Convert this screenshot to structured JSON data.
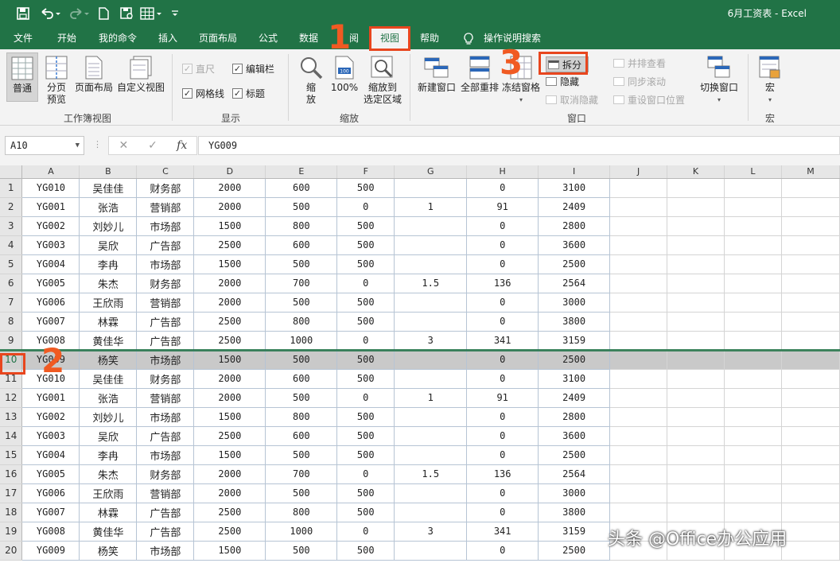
{
  "window": {
    "title": "6月工资表 - Excel"
  },
  "quick_access": {
    "icons": [
      "save-icon",
      "undo-icon",
      "redo-icon",
      "new-file-icon",
      "print-preview-icon",
      "table-icon",
      "customize-icon"
    ]
  },
  "tabs": [
    "文件",
    "开始",
    "我的命令",
    "插入",
    "页面布局",
    "公式",
    "数据",
    "审阅",
    "视图",
    "帮助"
  ],
  "tab_partial": "阅",
  "tab_active": "视图",
  "tell_me": "操作说明搜索",
  "ribbon": {
    "workbook_views": {
      "label": "工作簿视图",
      "buttons": [
        "普通",
        "分页\n预览",
        "页面布局",
        "自定义视图"
      ]
    },
    "show": {
      "label": "显示",
      "ruler": "直尺",
      "formula_bar": "编辑栏",
      "gridlines": "网格线",
      "headings": "标题"
    },
    "zoom": {
      "label": "缩放",
      "zoom": "缩\n放",
      "zoom100": "100%",
      "zoom_selection": "缩放到\n选定区域"
    },
    "window": {
      "label": "窗口",
      "new_window": "新建窗口",
      "arrange_all": "全部重排",
      "freeze_panes": "冻结窗格",
      "split": "拆分",
      "hide": "隐藏",
      "unhide": "取消隐藏",
      "view_side_by_side": "并排查看",
      "sync_scroll": "同步滚动",
      "reset_position": "重设窗口位置",
      "switch_windows": "切换窗口"
    },
    "macros": {
      "label": "宏",
      "button": "宏"
    }
  },
  "formula_bar": {
    "name_box": "A10",
    "cancel": "✕",
    "enter": "✓",
    "fx": "fx",
    "value": "YG009"
  },
  "sheet": {
    "columns": [
      "A",
      "B",
      "C",
      "D",
      "E",
      "F",
      "G",
      "H",
      "I",
      "J",
      "K",
      "L",
      "M"
    ],
    "selected_row": 10,
    "rows": [
      [
        "1",
        "YG010",
        "吴佳佳",
        "财务部",
        "2000",
        "600",
        "500",
        "",
        "0",
        "3100"
      ],
      [
        "2",
        "YG001",
        "张浩",
        "营销部",
        "2000",
        "500",
        "0",
        "1",
        "91",
        "2409"
      ],
      [
        "3",
        "YG002",
        "刘妙儿",
        "市场部",
        "1500",
        "800",
        "500",
        "",
        "0",
        "2800"
      ],
      [
        "4",
        "YG003",
        "吴欣",
        "广告部",
        "2500",
        "600",
        "500",
        "",
        "0",
        "3600"
      ],
      [
        "5",
        "YG004",
        "李冉",
        "市场部",
        "1500",
        "500",
        "500",
        "",
        "0",
        "2500"
      ],
      [
        "6",
        "YG005",
        "朱杰",
        "财务部",
        "2000",
        "700",
        "0",
        "1.5",
        "136",
        "2564"
      ],
      [
        "7",
        "YG006",
        "王欣雨",
        "营销部",
        "2000",
        "500",
        "500",
        "",
        "0",
        "3000"
      ],
      [
        "8",
        "YG007",
        "林霖",
        "广告部",
        "2500",
        "800",
        "500",
        "",
        "0",
        "3800"
      ],
      [
        "9",
        "YG008",
        "黄佳华",
        "广告部",
        "2500",
        "1000",
        "0",
        "3",
        "341",
        "3159"
      ],
      [
        "10",
        "YG009",
        "杨笑",
        "市场部",
        "1500",
        "500",
        "500",
        "",
        "0",
        "2500"
      ],
      [
        "11",
        "YG010",
        "吴佳佳",
        "财务部",
        "2000",
        "600",
        "500",
        "",
        "0",
        "3100"
      ],
      [
        "12",
        "YG001",
        "张浩",
        "营销部",
        "2000",
        "500",
        "0",
        "1",
        "91",
        "2409"
      ],
      [
        "13",
        "YG002",
        "刘妙儿",
        "市场部",
        "1500",
        "800",
        "500",
        "",
        "0",
        "2800"
      ],
      [
        "14",
        "YG003",
        "吴欣",
        "广告部",
        "2500",
        "600",
        "500",
        "",
        "0",
        "3600"
      ],
      [
        "15",
        "YG004",
        "李冉",
        "市场部",
        "1500",
        "500",
        "500",
        "",
        "0",
        "2500"
      ],
      [
        "16",
        "YG005",
        "朱杰",
        "财务部",
        "2000",
        "700",
        "0",
        "1.5",
        "136",
        "2564"
      ],
      [
        "17",
        "YG006",
        "王欣雨",
        "营销部",
        "2000",
        "500",
        "500",
        "",
        "0",
        "3000"
      ],
      [
        "18",
        "YG007",
        "林霖",
        "广告部",
        "2500",
        "800",
        "500",
        "",
        "0",
        "3800"
      ],
      [
        "19",
        "YG008",
        "黄佳华",
        "广告部",
        "2500",
        "1000",
        "0",
        "3",
        "341",
        "3159"
      ],
      [
        "20",
        "YG009",
        "杨笑",
        "市场部",
        "1500",
        "500",
        "500",
        "",
        "0",
        "2500"
      ]
    ]
  },
  "annotations": {
    "step1": "1",
    "step2": "2",
    "step3": "3"
  },
  "watermark": "头条 @Office办公应用",
  "colors": {
    "brand": "#217346",
    "annotation": "#e8461e",
    "selected_row": "#c9c9c9"
  }
}
